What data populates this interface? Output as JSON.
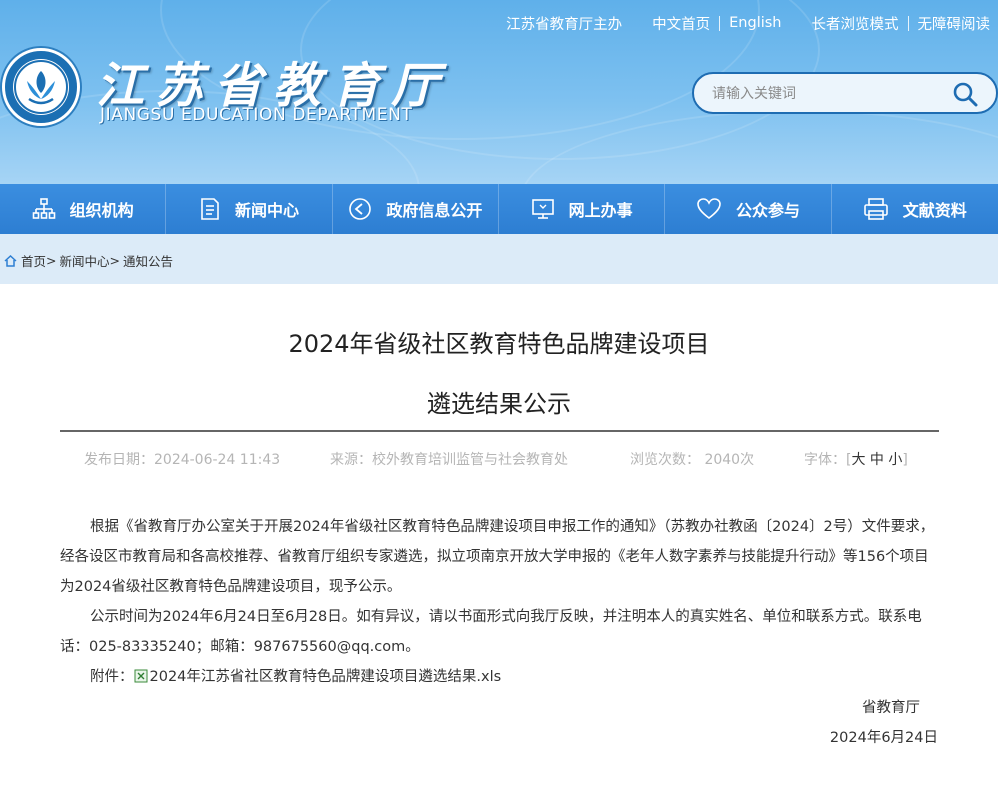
{
  "top_links": {
    "sponsor": "江苏省教育厅主办",
    "home_cn": "中文首页",
    "english": "English",
    "elder_mode": "长者浏览模式",
    "accessible": "无障碍阅读"
  },
  "logo": {
    "title": "江苏省教育厅",
    "subtitle": "JIANGSU EDUCATION DEPARTMENT"
  },
  "search": {
    "placeholder": "请输入关键词"
  },
  "nav": [
    {
      "label": "组织机构",
      "icon": "org-chart-icon"
    },
    {
      "label": "新闻中心",
      "icon": "document-icon"
    },
    {
      "label": "政府信息公开",
      "icon": "announce-icon"
    },
    {
      "label": "网上办事",
      "icon": "monitor-icon"
    },
    {
      "label": "公众参与",
      "icon": "heart-icon"
    },
    {
      "label": "文献资料",
      "icon": "printer-icon"
    }
  ],
  "breadcrumb": {
    "home": "首页",
    "sep1": ">",
    "news": "新闻中心",
    "sep2": ">",
    "notice": "通知公告"
  },
  "article": {
    "title_line1": "2024年省级社区教育特色品牌建设项目",
    "title_line2": "遴选结果公示",
    "meta": {
      "date": "发布日期：2024-06-24 11:43",
      "source": "来源：校外教育培训监管与社会教育处",
      "views": "浏览次数： 2040次",
      "font_label": "字体：",
      "bracket_open": "[",
      "font_large": "大",
      "font_medium": "中",
      "font_small": "小",
      "bracket_close": "]"
    },
    "paragraph1": "根据《省教育厅办公室关于开展2024年省级社区教育特色品牌建设项目申报工作的通知》（苏教办社教函〔2024〕2号）文件要求，经各设区市教育局和各高校推荐、省教育厅组织专家遴选，拟立项南京开放大学申报的《老年人数字素养与技能提升行动》等156个项目为2024省级社区教育特色品牌建设项目，现予公示。",
    "paragraph2": "公示时间为2024年6月24日至6月28日。如有异议，请以书面形式向我厅反映，并注明本人的真实姓名、单位和联系方式。联系电话：025-83335240；邮箱：987675560@qq.com。",
    "attachment_label": "附件：",
    "attachment_name": "2024年江苏省社区教育特色品牌建设项目遴选结果.xls",
    "signature": "省教育厅",
    "sign_date": "2024年6月24日"
  },
  "colors": {
    "nav_bg": "#3b8ee0",
    "header_bg": "#7ec1f0",
    "breadcrumb_bg": "#dcebf8",
    "search_border": "#1e6cb2"
  }
}
